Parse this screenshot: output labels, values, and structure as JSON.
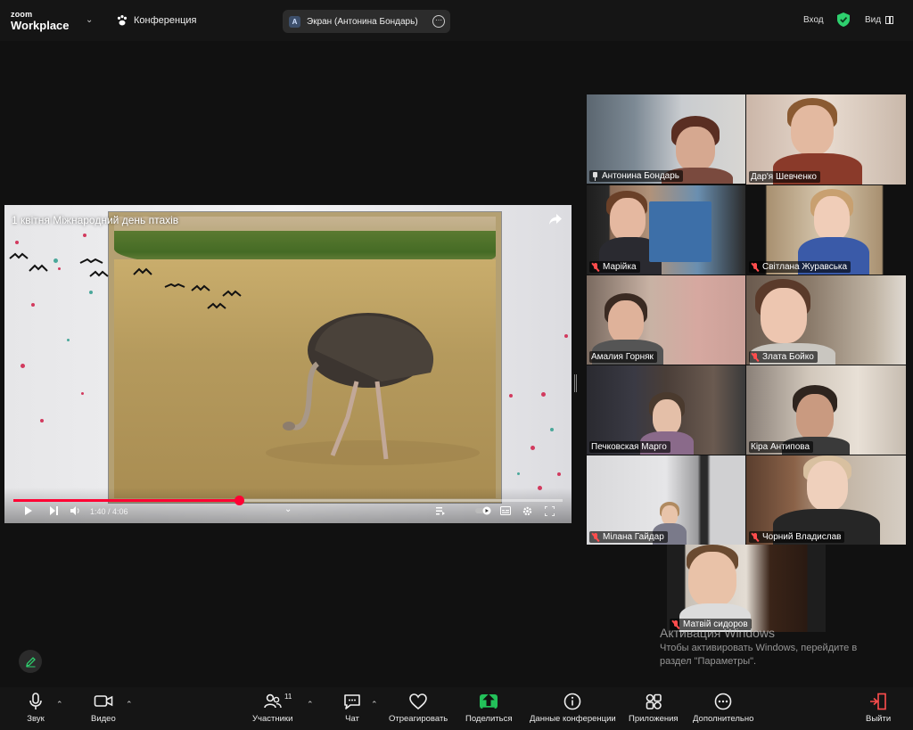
{
  "top_bar": {
    "logo_line1": "zoom",
    "logo_line2": "Workplace",
    "meeting_type": "Конференция",
    "screen_share_label": "Экран (Антонина Бондарь)",
    "screen_share_avatar": "А",
    "signin_label": "Вход",
    "view_label": "Вид"
  },
  "player": {
    "title": "1 квітня Міжнародний день птахів",
    "time": "1:40 / 4:06",
    "progress_fraction": 0.41,
    "accent_color": "#ff0033"
  },
  "participants": [
    {
      "name": "Антонина Бондарь",
      "muted": false,
      "pinned": true,
      "speaking": false
    },
    {
      "name": "Дар'я Шевченко",
      "muted": false,
      "pinned": false,
      "speaking": true
    },
    {
      "name": "Марійка",
      "muted": true,
      "pinned": false,
      "speaking": false
    },
    {
      "name": "Світлана Журавська",
      "muted": true,
      "pinned": false,
      "speaking": false
    },
    {
      "name": "Амалия Горняк",
      "muted": false,
      "pinned": false,
      "speaking": false
    },
    {
      "name": "Злата Бойко",
      "muted": true,
      "pinned": false,
      "speaking": false
    },
    {
      "name": "Печковская Марго",
      "muted": false,
      "pinned": false,
      "speaking": false
    },
    {
      "name": "Кіра Антипова",
      "muted": false,
      "pinned": false,
      "speaking": false
    },
    {
      "name": "Мілана Гайдар",
      "muted": true,
      "pinned": false,
      "speaking": false
    },
    {
      "name": "Чорний Владислав",
      "muted": true,
      "pinned": false,
      "speaking": false
    },
    {
      "name": "Матвій сидоров",
      "muted": true,
      "pinned": false,
      "speaking": false
    }
  ],
  "watermark": {
    "line1": "Активация Windows",
    "line2": "Чтобы активировать Windows, перейдите в",
    "line3": "раздел \"Параметры\"."
  },
  "toolbar": {
    "audio": "Звук",
    "video": "Видео",
    "participants": "Участники",
    "participants_count": "11",
    "chat": "Чат",
    "react": "Отреагировать",
    "share": "Поделиться",
    "meeting_info": "Данные конференции",
    "apps": "Приложения",
    "more": "Дополнительно",
    "leave": "Выйти"
  },
  "colors": {
    "speaking_outline": "#2ed06e",
    "share_button": "#23c15a",
    "leave_icon": "#ff4d4d",
    "shield": "#2ed06e"
  }
}
